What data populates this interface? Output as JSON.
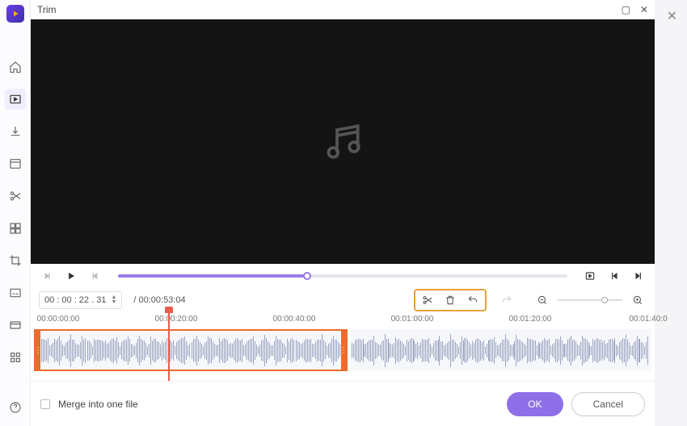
{
  "dialog": {
    "title": "Trim"
  },
  "transport": {
    "current_time": "00 : 00 : 22 . 31",
    "duration": "/ 00:00:53:04",
    "progress_pct": 42
  },
  "ruler": {
    "ticks": [
      "00:00:00:00",
      "00:00:20:00",
      "00:00:40:00",
      "00:01:00:00",
      "00:01:20:00",
      "00:01:40:0"
    ]
  },
  "footer": {
    "merge_label": "Merge into one file",
    "ok": "OK",
    "cancel": "Cancel"
  }
}
